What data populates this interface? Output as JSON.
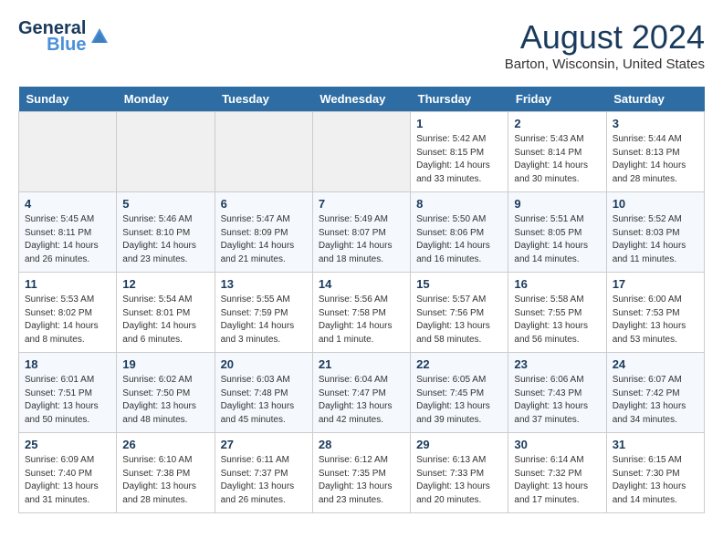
{
  "logo": {
    "line1": "General",
    "line2": "Blue"
  },
  "title": "August 2024",
  "location": "Barton, Wisconsin, United States",
  "days_of_week": [
    "Sunday",
    "Monday",
    "Tuesday",
    "Wednesday",
    "Thursday",
    "Friday",
    "Saturday"
  ],
  "weeks": [
    [
      {
        "day": "",
        "info": ""
      },
      {
        "day": "",
        "info": ""
      },
      {
        "day": "",
        "info": ""
      },
      {
        "day": "",
        "info": ""
      },
      {
        "day": "1",
        "info": "Sunrise: 5:42 AM\nSunset: 8:15 PM\nDaylight: 14 hours\nand 33 minutes."
      },
      {
        "day": "2",
        "info": "Sunrise: 5:43 AM\nSunset: 8:14 PM\nDaylight: 14 hours\nand 30 minutes."
      },
      {
        "day": "3",
        "info": "Sunrise: 5:44 AM\nSunset: 8:13 PM\nDaylight: 14 hours\nand 28 minutes."
      }
    ],
    [
      {
        "day": "4",
        "info": "Sunrise: 5:45 AM\nSunset: 8:11 PM\nDaylight: 14 hours\nand 26 minutes."
      },
      {
        "day": "5",
        "info": "Sunrise: 5:46 AM\nSunset: 8:10 PM\nDaylight: 14 hours\nand 23 minutes."
      },
      {
        "day": "6",
        "info": "Sunrise: 5:47 AM\nSunset: 8:09 PM\nDaylight: 14 hours\nand 21 minutes."
      },
      {
        "day": "7",
        "info": "Sunrise: 5:49 AM\nSunset: 8:07 PM\nDaylight: 14 hours\nand 18 minutes."
      },
      {
        "day": "8",
        "info": "Sunrise: 5:50 AM\nSunset: 8:06 PM\nDaylight: 14 hours\nand 16 minutes."
      },
      {
        "day": "9",
        "info": "Sunrise: 5:51 AM\nSunset: 8:05 PM\nDaylight: 14 hours\nand 14 minutes."
      },
      {
        "day": "10",
        "info": "Sunrise: 5:52 AM\nSunset: 8:03 PM\nDaylight: 14 hours\nand 11 minutes."
      }
    ],
    [
      {
        "day": "11",
        "info": "Sunrise: 5:53 AM\nSunset: 8:02 PM\nDaylight: 14 hours\nand 8 minutes."
      },
      {
        "day": "12",
        "info": "Sunrise: 5:54 AM\nSunset: 8:01 PM\nDaylight: 14 hours\nand 6 minutes."
      },
      {
        "day": "13",
        "info": "Sunrise: 5:55 AM\nSunset: 7:59 PM\nDaylight: 14 hours\nand 3 minutes."
      },
      {
        "day": "14",
        "info": "Sunrise: 5:56 AM\nSunset: 7:58 PM\nDaylight: 14 hours\nand 1 minute."
      },
      {
        "day": "15",
        "info": "Sunrise: 5:57 AM\nSunset: 7:56 PM\nDaylight: 13 hours\nand 58 minutes."
      },
      {
        "day": "16",
        "info": "Sunrise: 5:58 AM\nSunset: 7:55 PM\nDaylight: 13 hours\nand 56 minutes."
      },
      {
        "day": "17",
        "info": "Sunrise: 6:00 AM\nSunset: 7:53 PM\nDaylight: 13 hours\nand 53 minutes."
      }
    ],
    [
      {
        "day": "18",
        "info": "Sunrise: 6:01 AM\nSunset: 7:51 PM\nDaylight: 13 hours\nand 50 minutes."
      },
      {
        "day": "19",
        "info": "Sunrise: 6:02 AM\nSunset: 7:50 PM\nDaylight: 13 hours\nand 48 minutes."
      },
      {
        "day": "20",
        "info": "Sunrise: 6:03 AM\nSunset: 7:48 PM\nDaylight: 13 hours\nand 45 minutes."
      },
      {
        "day": "21",
        "info": "Sunrise: 6:04 AM\nSunset: 7:47 PM\nDaylight: 13 hours\nand 42 minutes."
      },
      {
        "day": "22",
        "info": "Sunrise: 6:05 AM\nSunset: 7:45 PM\nDaylight: 13 hours\nand 39 minutes."
      },
      {
        "day": "23",
        "info": "Sunrise: 6:06 AM\nSunset: 7:43 PM\nDaylight: 13 hours\nand 37 minutes."
      },
      {
        "day": "24",
        "info": "Sunrise: 6:07 AM\nSunset: 7:42 PM\nDaylight: 13 hours\nand 34 minutes."
      }
    ],
    [
      {
        "day": "25",
        "info": "Sunrise: 6:09 AM\nSunset: 7:40 PM\nDaylight: 13 hours\nand 31 minutes."
      },
      {
        "day": "26",
        "info": "Sunrise: 6:10 AM\nSunset: 7:38 PM\nDaylight: 13 hours\nand 28 minutes."
      },
      {
        "day": "27",
        "info": "Sunrise: 6:11 AM\nSunset: 7:37 PM\nDaylight: 13 hours\nand 26 minutes."
      },
      {
        "day": "28",
        "info": "Sunrise: 6:12 AM\nSunset: 7:35 PM\nDaylight: 13 hours\nand 23 minutes."
      },
      {
        "day": "29",
        "info": "Sunrise: 6:13 AM\nSunset: 7:33 PM\nDaylight: 13 hours\nand 20 minutes."
      },
      {
        "day": "30",
        "info": "Sunrise: 6:14 AM\nSunset: 7:32 PM\nDaylight: 13 hours\nand 17 minutes."
      },
      {
        "day": "31",
        "info": "Sunrise: 6:15 AM\nSunset: 7:30 PM\nDaylight: 13 hours\nand 14 minutes."
      }
    ]
  ]
}
